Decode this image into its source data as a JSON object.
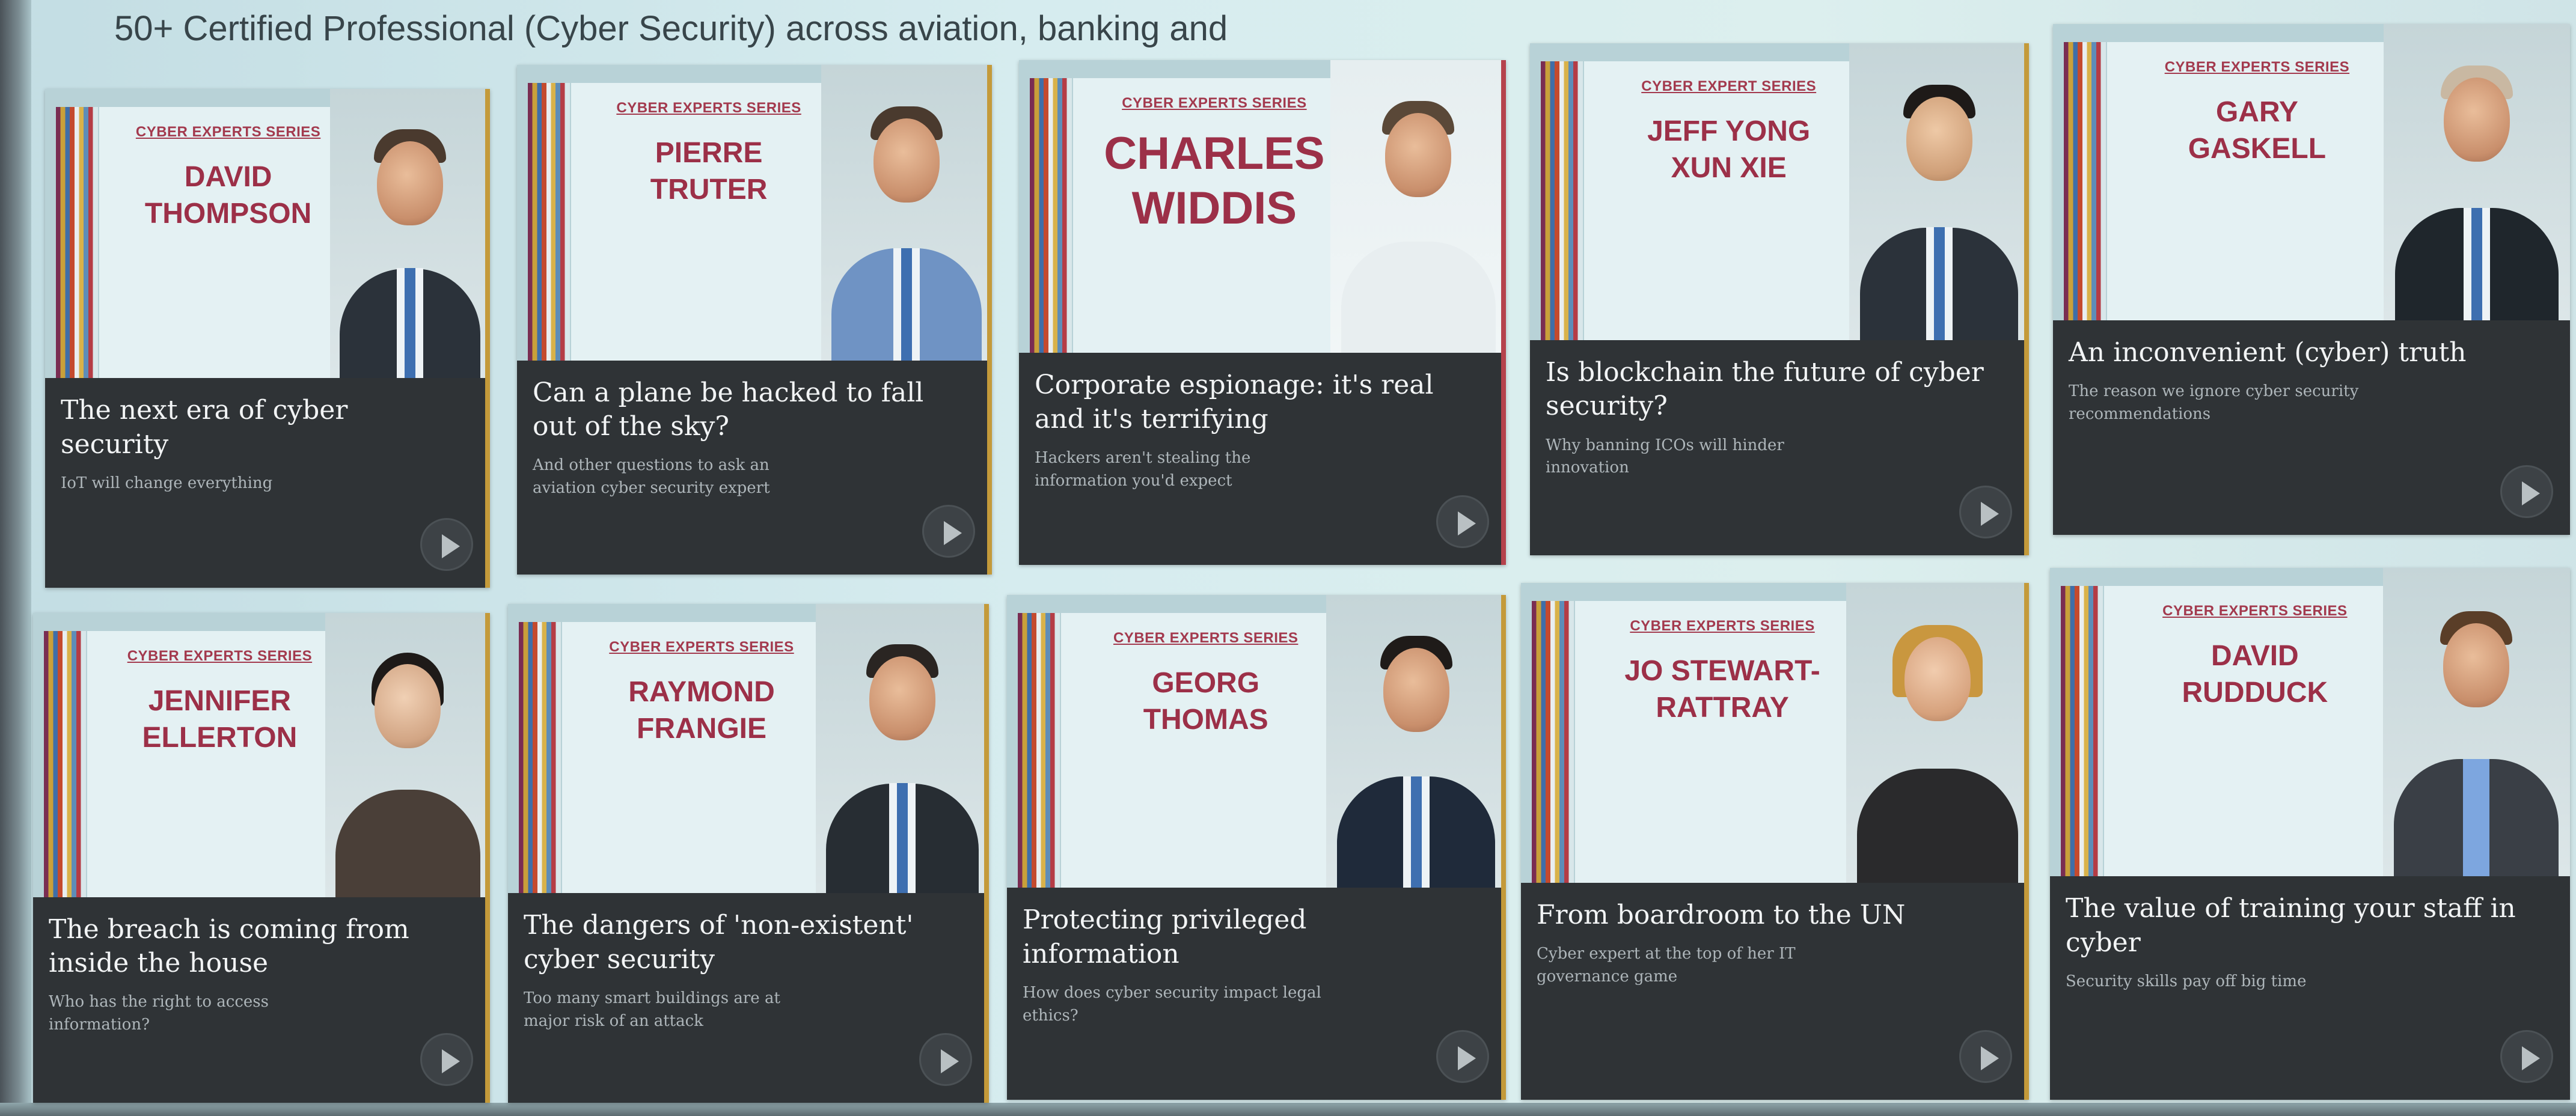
{
  "headline": "50+ Certified Professional (Cyber Security) across aviation, banking and",
  "series_label": "CYBER EXPERTS SERIES",
  "series_label_alt": "CYBER EXPERT SERIES",
  "cards": [
    {
      "name": "DAVID\nTHOMPSON",
      "title": "The next era of cyber security",
      "subtitle": "IoT will change everything",
      "edge_color": "#c49a3a"
    },
    {
      "name": "PIERRE\nTRUTER",
      "title": "Can a plane be hacked to fall out of the sky?",
      "subtitle": "And other questions to ask an aviation cyber security expert",
      "edge_color": "#c49a3a"
    },
    {
      "name": "CHARLES\nWIDDIS",
      "title": "Corporate espionage: it's real and it's terrifying",
      "subtitle": "Hackers aren't stealing the information you'd expect",
      "edge_color": "#b5424c"
    },
    {
      "name": "JEFF YONG\nXUN XIE",
      "title": "Is blockchain the future of cyber security?",
      "subtitle": "Why banning ICOs will hinder innovation",
      "edge_color": "#c49a3a"
    },
    {
      "name": "GARY\nGASKELL",
      "title": "An inconvenient (cyber) truth",
      "subtitle": "The reason we ignore cyber security recommendations",
      "edge_color": "#c49a3a"
    },
    {
      "name": "JENNIFER\nELLERTON",
      "title": "The breach is coming from inside the house",
      "subtitle": "Who has the right to access information?",
      "edge_color": "#c49a3a"
    },
    {
      "name": "RAYMOND\nFRANGIE",
      "title": "The dangers of 'non-existent' cyber security",
      "subtitle": "Too many smart buildings are at major risk of an attack",
      "edge_color": "#c49a3a"
    },
    {
      "name": "GEORG\nTHOMAS",
      "title": "Protecting privileged information",
      "subtitle": "How does cyber security impact legal ethics?",
      "edge_color": "#c49a3a"
    },
    {
      "name": "JO STEWART-\nRATTRAY",
      "title": "From boardroom to the UN",
      "subtitle": "Cyber expert at the top of her IT governance game",
      "edge_color": "#c49a3a"
    },
    {
      "name": "DAVID\nRUDDUCK",
      "title": "The value of training your staff in cyber",
      "subtitle": "Security skills pay off big time",
      "edge_color": "#c49a3a"
    }
  ]
}
